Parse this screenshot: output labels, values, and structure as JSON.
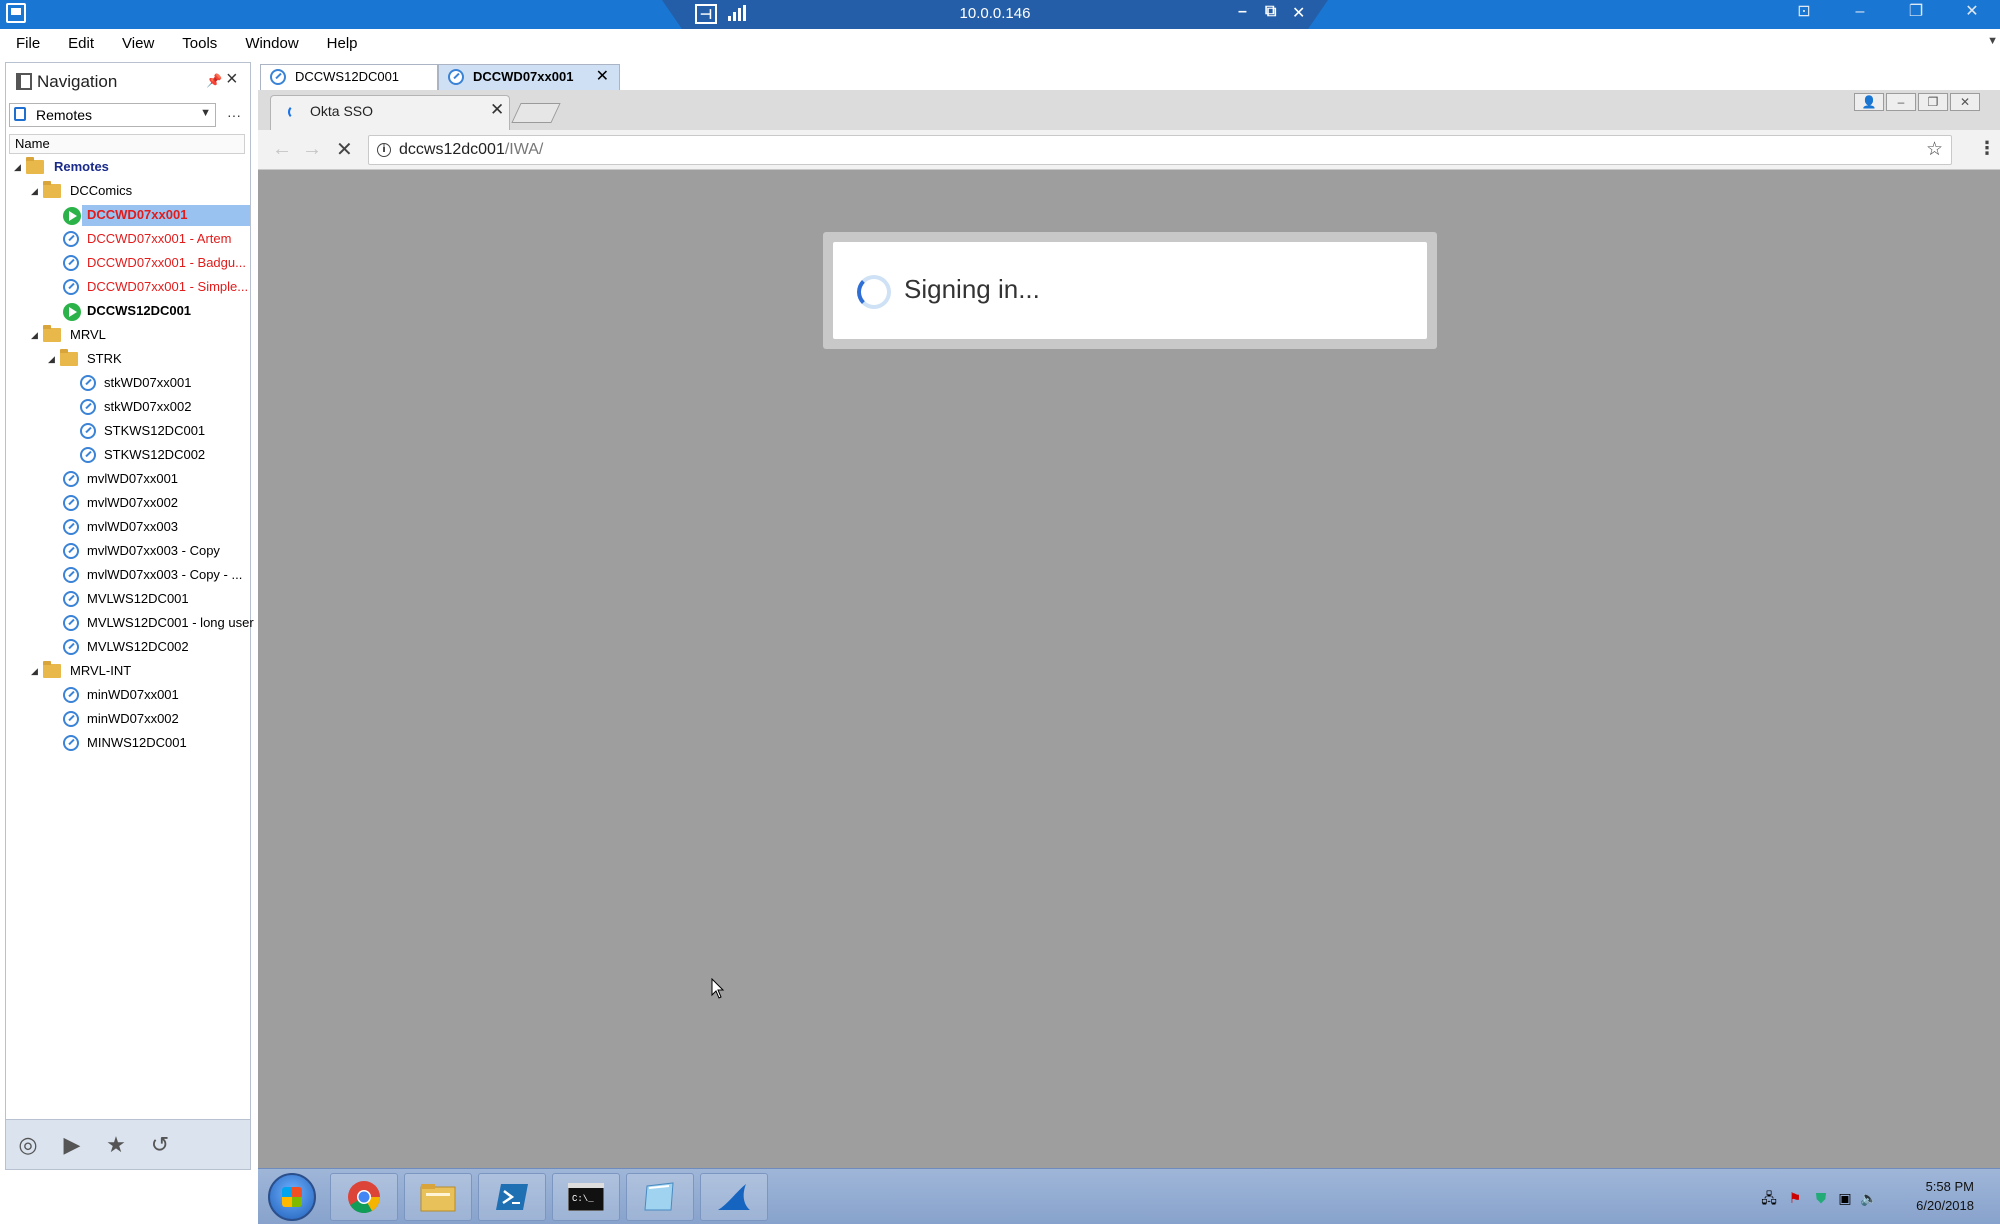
{
  "remote_bar": {
    "connection_title": "10.0.0.146"
  },
  "menu": {
    "items": [
      "File",
      "Edit",
      "View",
      "Tools",
      "Window",
      "Help"
    ]
  },
  "navigation": {
    "title": "Navigation",
    "filter_value": "Remotes",
    "column_header": "Name",
    "tree": [
      {
        "label": "Remotes",
        "type": "root"
      },
      {
        "label": "DCComics",
        "type": "folder"
      },
      {
        "label": "DCCWD07xx001",
        "type": "session-active",
        "selected": true
      },
      {
        "label": "DCCWD07xx001 - Artem",
        "type": "rdp"
      },
      {
        "label": "DCCWD07xx001 - Badgu...",
        "type": "rdp"
      },
      {
        "label": "DCCWD07xx001 - Simple...",
        "type": "rdp"
      },
      {
        "label": "DCCWS12DC001",
        "type": "session-active"
      },
      {
        "label": "MRVL",
        "type": "folder"
      },
      {
        "label": "STRK",
        "type": "folder"
      },
      {
        "label": "stkWD07xx001",
        "type": "rdp"
      },
      {
        "label": "stkWD07xx002",
        "type": "rdp"
      },
      {
        "label": "STKWS12DC001",
        "type": "rdp"
      },
      {
        "label": "STKWS12DC002",
        "type": "rdp"
      },
      {
        "label": "mvlWD07xx001",
        "type": "rdp"
      },
      {
        "label": "mvlWD07xx002",
        "type": "rdp"
      },
      {
        "label": "mvlWD07xx003",
        "type": "rdp"
      },
      {
        "label": "mvlWD07xx003 - Copy",
        "type": "rdp"
      },
      {
        "label": "mvlWD07xx003 - Copy - ...",
        "type": "rdp"
      },
      {
        "label": "MVLWS12DC001",
        "type": "rdp"
      },
      {
        "label": "MVLWS12DC001 - long user",
        "type": "rdp"
      },
      {
        "label": "MVLWS12DC002",
        "type": "rdp"
      },
      {
        "label": "MRVL-INT",
        "type": "folder"
      },
      {
        "label": "minWD07xx001",
        "type": "rdp"
      },
      {
        "label": "minWD07xx002",
        "type": "rdp"
      },
      {
        "label": "MINWS12DC001",
        "type": "rdp"
      }
    ]
  },
  "doc_tabs": [
    {
      "label": "DCCWS12DC001",
      "active": false
    },
    {
      "label": "DCCWD07xx001",
      "active": true
    }
  ],
  "browser": {
    "tab_title": "Okta SSO",
    "url_host": "dccws12dc001",
    "url_path": "/IWA/"
  },
  "dialog": {
    "message": "Signing in..."
  },
  "taskbar": {
    "apps": [
      "start-orb",
      "chrome",
      "file-explorer",
      "powershell",
      "command-prompt",
      "notepad",
      "wireshark"
    ],
    "time": "5:58 PM",
    "date": "6/20/2018"
  }
}
